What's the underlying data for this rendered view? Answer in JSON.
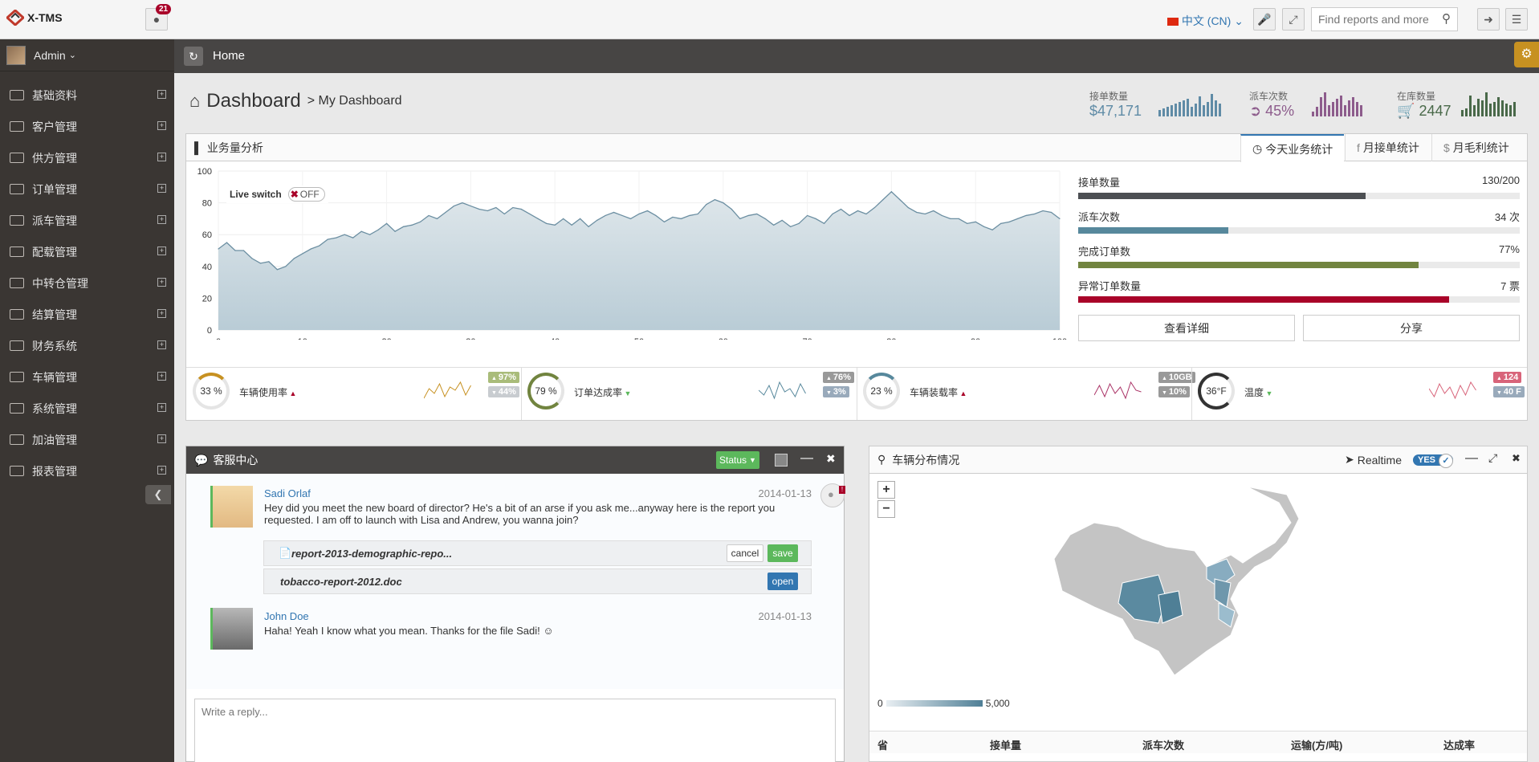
{
  "app": {
    "name": "X-TMS",
    "notifications": "21",
    "language": "中文 (CN)"
  },
  "search": {
    "placeholder": "Find reports and more"
  },
  "user": {
    "name": "Admin"
  },
  "sidebar": {
    "items": [
      "基础资料",
      "客户管理",
      "供方管理",
      "订单管理",
      "派车管理",
      "配载管理",
      "中转仓管理",
      "结算管理",
      "财务系统",
      "车辆管理",
      "系统管理",
      "加油管理",
      "报表管理"
    ]
  },
  "ribbon": {
    "breadcrumb": "Home"
  },
  "page": {
    "title": "Dashboard",
    "subtitle": "> My Dashboard"
  },
  "stats": [
    {
      "label": "接单数量",
      "value": "$47,171",
      "color": "#5f8ba6"
    },
    {
      "label": "派车次数",
      "value": "45%",
      "color": "#8d5c8c"
    },
    {
      "label": "在库数量",
      "value": "2447",
      "color": "#496949"
    }
  ],
  "analysis": {
    "title": "业务量分析",
    "tabs": [
      "今天业务统计",
      "月接单统计",
      "月毛利统计"
    ],
    "live_switch": "Live switch",
    "live_state": "OFF",
    "progress": [
      {
        "label": "接单数量",
        "value": "130/200",
        "fraction": 0.65,
        "color": "#4c4f53"
      },
      {
        "label": "派车次数",
        "value": "34 次",
        "fraction": 0.34,
        "color": "#57889c"
      },
      {
        "label": "完成订单数",
        "value": "77%",
        "fraction": 0.77,
        "color": "#71843f"
      },
      {
        "label": "异常订单数量",
        "value": "7 票",
        "fraction": 0.84,
        "color": "#a90329"
      }
    ],
    "buttons": [
      "查看详细",
      "分享"
    ]
  },
  "chart_data": {
    "type": "area",
    "title": "",
    "xlabel": "",
    "ylabel": "",
    "xlim": [
      0,
      100
    ],
    "ylim": [
      0,
      100
    ],
    "x_ticks": [
      0,
      10,
      20,
      30,
      40,
      50,
      60,
      70,
      80,
      90,
      100
    ],
    "y_ticks": [
      0,
      20,
      40,
      60,
      80,
      100
    ],
    "x": [
      0,
      1,
      2,
      3,
      4,
      5,
      6,
      7,
      8,
      9,
      10,
      11,
      12,
      13,
      14,
      15,
      16,
      17,
      18,
      19,
      20,
      21,
      22,
      23,
      24,
      25,
      26,
      27,
      28,
      29,
      30,
      31,
      32,
      33,
      34,
      35,
      36,
      37,
      38,
      39,
      40,
      41,
      42,
      43,
      44,
      45,
      46,
      47,
      48,
      49,
      50,
      51,
      52,
      53,
      54,
      55,
      56,
      57,
      58,
      59,
      60,
      61,
      62,
      63,
      64,
      65,
      66,
      67,
      68,
      69,
      70,
      71,
      72,
      73,
      74,
      75,
      76,
      77,
      78,
      79,
      80,
      81,
      82,
      83,
      84,
      85,
      86,
      87,
      88,
      89,
      90,
      91,
      92,
      93,
      94,
      95,
      96,
      97,
      98,
      99,
      100
    ],
    "values": [
      51,
      55,
      50,
      50,
      45,
      42,
      43,
      38,
      40,
      45,
      48,
      51,
      53,
      57,
      58,
      60,
      58,
      62,
      60,
      63,
      67,
      62,
      65,
      66,
      68,
      72,
      70,
      74,
      78,
      80,
      78,
      76,
      75,
      77,
      73,
      77,
      76,
      73,
      70,
      67,
      66,
      70,
      66,
      70,
      65,
      69,
      72,
      74,
      72,
      70,
      73,
      75,
      72,
      68,
      71,
      70,
      72,
      73,
      79,
      82,
      80,
      76,
      70,
      72,
      73,
      70,
      66,
      69,
      65,
      67,
      72,
      70,
      67,
      73,
      76,
      72,
      75,
      73,
      77,
      82,
      87,
      82,
      77,
      74,
      73,
      75,
      72,
      70,
      70,
      67,
      68,
      65,
      63,
      67,
      68,
      70,
      72,
      73,
      75,
      74,
      70
    ]
  },
  "kpis": [
    {
      "label": "车辆使用率",
      "percent": "33 %",
      "fraction": 0.33,
      "ring": "#c79121",
      "arrow": "up",
      "chips": [
        "97%",
        "44%"
      ],
      "chip_colors": [
        "#a9bc7a",
        "#c8ccd0"
      ]
    },
    {
      "label": "订单达成率",
      "percent": "79 %",
      "fraction": 0.79,
      "ring": "#71843f",
      "arrow": "down",
      "chips": [
        "76%",
        "3%"
      ],
      "chip_colors": [
        "#999",
        "#9ab"
      ]
    },
    {
      "label": "车辆装载率",
      "percent": "23 %",
      "fraction": 0.23,
      "ring": "#57889c",
      "arrow": "up",
      "chips": [
        "10GB",
        "10%"
      ],
      "chip_colors": [
        "#999",
        "#999"
      ]
    },
    {
      "label": "温度",
      "percent": "36°F",
      "fraction": 0.85,
      "ring": "#333",
      "arrow": "down",
      "chips": [
        "124",
        "40 F"
      ],
      "chip_colors": [
        "#d8647a",
        "#9ab"
      ]
    }
  ],
  "chat": {
    "title": "客服中心",
    "status_label": "Status",
    "messages": [
      {
        "name": "Sadi Orlaf",
        "date": "2014-01-13",
        "text": "Hey did you meet the new board of director? He's a bit of an arse if you ask me...anyway here is the report you requested. I am off to launch with Lisa and Andrew, you wanna join?"
      },
      {
        "name": "John Doe",
        "date": "2014-01-13",
        "text": "Haha! Yeah I know what you mean. Thanks for the file Sadi! ☺"
      }
    ],
    "files": [
      {
        "name": "report-2013-demographic-repo...",
        "actions": [
          "cancel",
          "save"
        ]
      },
      {
        "name": "tobacco-report-2012.doc",
        "actions": [
          "open"
        ]
      }
    ],
    "reply_placeholder": "Write a reply..."
  },
  "map": {
    "title": "车辆分布情况",
    "realtime": "Realtime",
    "toggle": "YES",
    "legend_min": "0",
    "legend_max": "5,000",
    "columns": [
      "省",
      "接单量",
      "派车次数",
      "运输(方/吨)",
      "达成率"
    ]
  }
}
